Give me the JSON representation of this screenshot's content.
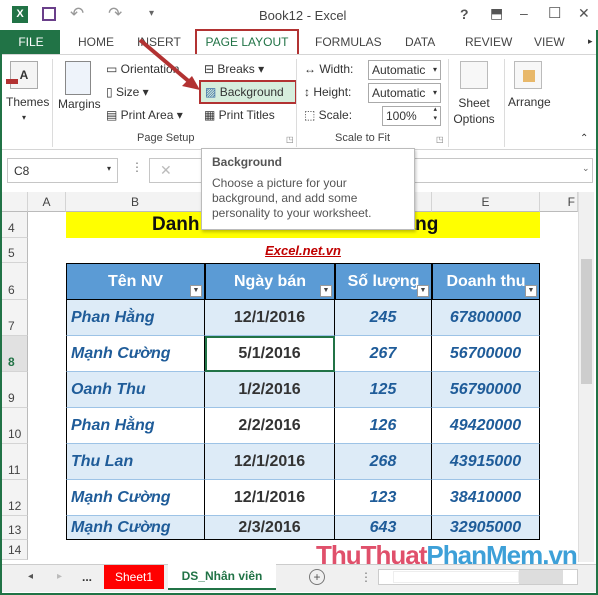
{
  "window": {
    "title": "Book12 - Excel",
    "help": "?",
    "restore_ribbon": "⬒",
    "minimize": "–",
    "maximize": "☐",
    "close": "✕"
  },
  "quick_access": {
    "undo": "↶",
    "redo": "↷",
    "customize": "▾"
  },
  "tabs": [
    {
      "label": "FILE"
    },
    {
      "label": "HOME"
    },
    {
      "label": "INSERT"
    },
    {
      "label": "PAGE LAYOUT"
    },
    {
      "label": "FORMULAS"
    },
    {
      "label": "DATA"
    },
    {
      "label": "REVIEW"
    },
    {
      "label": "VIEW"
    }
  ],
  "ribbon": {
    "themes": "Themes",
    "margins": "Margins",
    "orientation": "Orientation",
    "size": "Size",
    "print_area": "Print Area",
    "breaks": "Breaks",
    "background": "Background",
    "print_titles": "Print Titles",
    "group_page_setup": "Page Setup",
    "width_label": "Width:",
    "width_value": "Automatic",
    "height_label": "Height:",
    "height_value": "Automatic",
    "scale_label": "Scale:",
    "scale_value": "100%",
    "group_scale": "Scale to Fit",
    "sheet_options": "Sheet Options",
    "arrange": "Arrange"
  },
  "tooltip": {
    "title": "Background",
    "body": "Choose a picture for your background, and add some personality to your worksheet."
  },
  "formula_bar": {
    "name_box": "C8",
    "cancel": "✕",
    "value": ""
  },
  "columns": [
    "A",
    "B",
    "C",
    "D",
    "E",
    "F"
  ],
  "sheet": {
    "title": "Danh sách nhân viên bán hàng",
    "title_visible_left": "Danh",
    "title_visible_right": "hàng",
    "link": "Excel.net.vn",
    "headers": [
      "Tên NV",
      "Ngày bán",
      "Số lượng",
      "Doanh thu"
    ],
    "rows": [
      {
        "row": "7",
        "name": "Phan Hằng",
        "date": "12/1/2016",
        "qty": "245",
        "revenue": "67800000"
      },
      {
        "row": "8",
        "name": "Mạnh Cường",
        "date": "5/1/2016",
        "qty": "267",
        "revenue": "56700000"
      },
      {
        "row": "9",
        "name": "Oanh Thu",
        "date": "1/2/2016",
        "qty": "125",
        "revenue": "56790000"
      },
      {
        "row": "10",
        "name": "Phan Hằng",
        "date": "2/2/2016",
        "qty": "126",
        "revenue": "49420000"
      },
      {
        "row": "11",
        "name": "Thu Lan",
        "date": "12/1/2016",
        "qty": "268",
        "revenue": "43915000"
      },
      {
        "row": "12",
        "name": "Mạnh Cường",
        "date": "12/1/2016",
        "qty": "123",
        "revenue": "38410000"
      },
      {
        "row": "13",
        "name": "Mạnh Cường",
        "date": "2/3/2016",
        "qty": "643",
        "revenue": "32905000"
      }
    ],
    "row_numbers": [
      "4",
      "5",
      "6",
      "14"
    ]
  },
  "sheet_tabs": {
    "ellipsis": "...",
    "tabs": [
      "Sheet1",
      "DS_Nhân viên"
    ],
    "add": "+"
  },
  "watermark": {
    "part1": "ThuThuat",
    "part2": "PhanMem.vn"
  },
  "colors": {
    "excel_green": "#217346",
    "header_blue": "#5b9bd5",
    "title_yellow": "#ffff00",
    "text_blue": "#1f5c99",
    "highlight_red": "#b23232",
    "sheet1_red": "#ff0000"
  }
}
